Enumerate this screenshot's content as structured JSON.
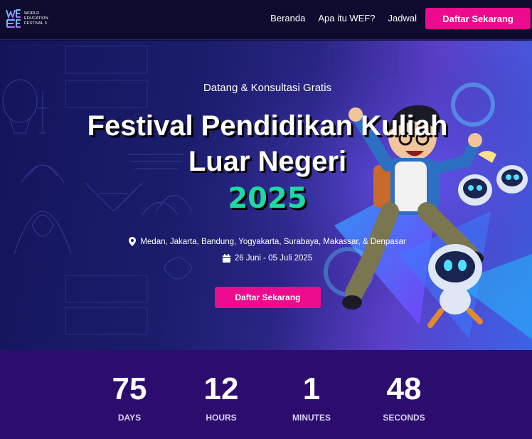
{
  "nav": {
    "logo_lines": [
      "WORLD",
      "EDUCATION",
      "FESTIVAL 3"
    ],
    "links": [
      "Beranda",
      "Apa itu WEF?",
      "Jadwal"
    ],
    "cta_label": "Daftar Sekarang"
  },
  "hero": {
    "tagline": "Datang & Konsultasi Gratis",
    "title_line1": "Festival Pendidikan Kuliah",
    "title_line2": "Luar Negeri",
    "year": "2025",
    "locations": "Medan, Jakarta, Bandung, Yogyakarta, Surabaya, Makassar, & Denpasar",
    "dates": "26 Juni - 05 Juli 2025",
    "cta_label": "Daftar Sekarang"
  },
  "countdown": {
    "days": "75",
    "days_label": "DAYS",
    "hours": "12",
    "hours_label": "HOURS",
    "minutes": "1",
    "minutes_label": "MINUTES",
    "seconds": "48",
    "seconds_label": "SECONDS"
  },
  "colors": {
    "accent_pink": "#ec0b8d",
    "year_green": "#1fd9a4",
    "countdown_bg": "#2c0d6e",
    "nav_bg": "#0f0b2e"
  },
  "icons": [
    "logo-mark",
    "map-pin-icon",
    "calendar-icon",
    "character-illustration",
    "robot-illustration"
  ]
}
